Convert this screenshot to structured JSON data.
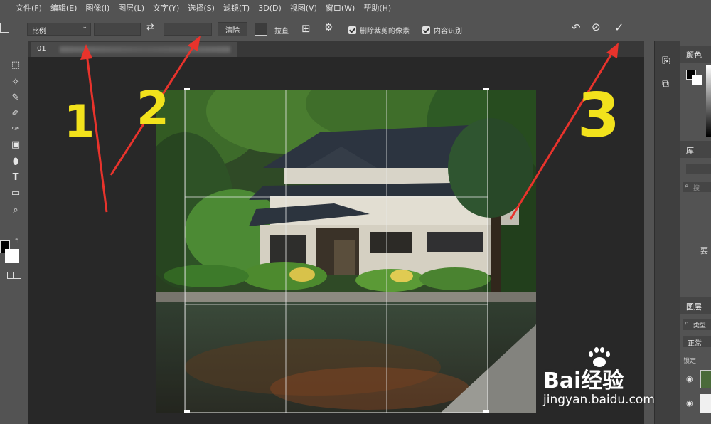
{
  "menu": [
    "文件(F)",
    "编辑(E)",
    "图像(I)",
    "图层(L)",
    "文字(Y)",
    "选择(S)",
    "滤镜(T)",
    "3D(D)",
    "视图(V)",
    "窗口(W)",
    "帮助(H)"
  ],
  "options": {
    "ratio_select": "比例",
    "clear_button": "清除",
    "straighten_label": "拉直",
    "delete_pixels_label": "删除裁剪的像素",
    "content_aware_label": "内容识别"
  },
  "document": {
    "tab_title": "01"
  },
  "panels": {
    "color_tab": "颜色",
    "library_tab": "库",
    "search_placeholder": "搜",
    "layers_tab": "图层",
    "layers_kind_placeholder": "类型",
    "blend_mode": "正常",
    "lock_label": "锁定:",
    "partial_text": "要"
  },
  "annotations": {
    "num1": "1",
    "num2": "2",
    "num3": "3"
  },
  "watermark": {
    "brand": "Bai经验",
    "url": "jingyan.baidu.com"
  },
  "colors": {
    "annotation_yellow": "#f2e21c",
    "arrow_red": "#e8332c",
    "panel_bg": "#535353"
  }
}
